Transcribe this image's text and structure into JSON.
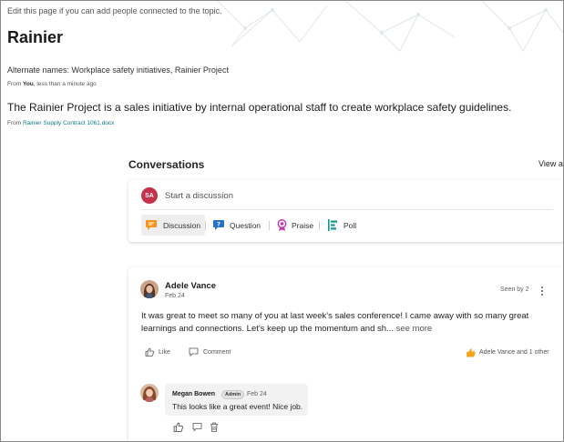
{
  "page": {
    "hint": "Edit this page if you can add people connected to the topic.",
    "title": "Rainier",
    "alternate_names": "Alternate names: Workplace safety initiatives, Rainier Project",
    "source_from_label": "From",
    "source_from_who": "You",
    "source_from_when": ", less than a minute ago",
    "description": "The Rainier Project is a sales initiative by internal operational staff to create workplace safety guidelines.",
    "doc_from_label": "From",
    "doc_link": "Rainier Supply Contract 1061.docx"
  },
  "conversations": {
    "title": "Conversations",
    "view_all": "View all",
    "composer": {
      "avatar_initials": "SA",
      "placeholder": "Start a discussion",
      "post_types": [
        {
          "label": "Discussion",
          "icon": "discussion-icon",
          "active": true
        },
        {
          "label": "Question",
          "icon": "question-icon",
          "active": false
        },
        {
          "label": "Praise",
          "icon": "praise-icon",
          "active": false
        },
        {
          "label": "Poll",
          "icon": "poll-icon",
          "active": false
        }
      ]
    },
    "post": {
      "author": "Adele Vance",
      "date": "Feb 24",
      "seen_by": "Seen by 2",
      "body": "It was great to meet so many of you at last week's sales conference! I came away with so many great learnings and connections. Let's keep up the momentum and sh...",
      "see_more": "see more",
      "like_label": "Like",
      "comment_label": "Comment",
      "reactions": "Adele Vance and 1 other",
      "reply": {
        "author": "Megan Bowen",
        "badge": "Admin",
        "date": "Feb 24",
        "text": "This looks like a great event! Nice job."
      }
    }
  },
  "colors": {
    "accent": "#0e7c86",
    "avatar_sa": "#c4314b",
    "discussion": "#f7941d",
    "question": "#2672c9",
    "praise": "#c239b3",
    "poll": "#0e9a8a",
    "like_reaction": "#f7a41d"
  }
}
